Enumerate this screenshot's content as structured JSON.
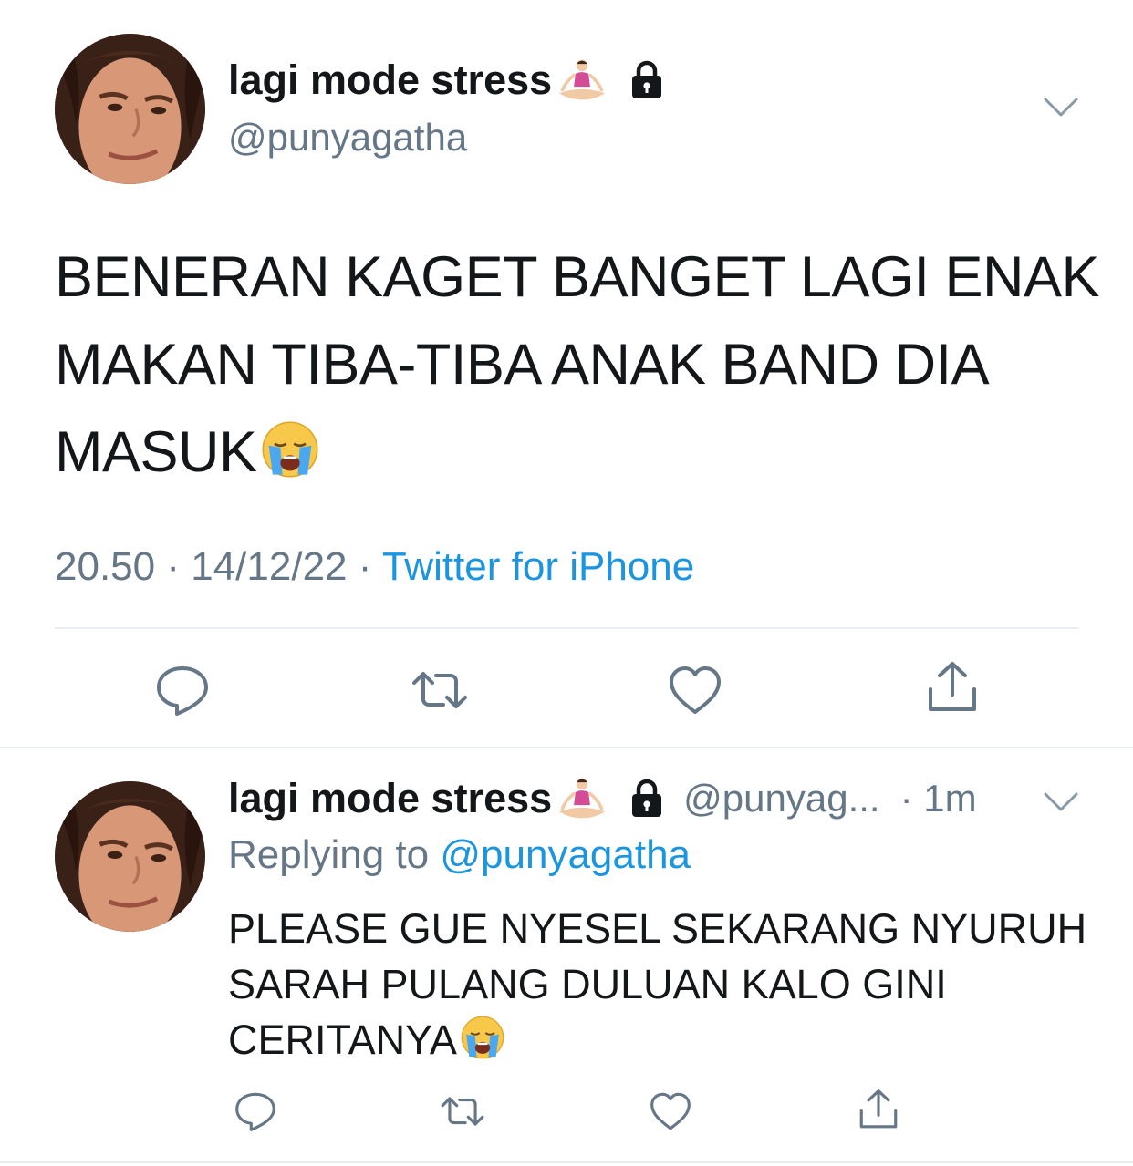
{
  "main_tweet": {
    "display_name": "lagi mode stress",
    "name_emoji": "person-in-lotus-position-emoji",
    "protected_icon": "lock-icon",
    "handle": "@punyagatha",
    "text": "BENERAN KAGET BANGET LAGI ENAK MAKAN TIBA-TIBA ANAK BAND DIA MASUK",
    "text_emoji": "loudly-crying-face-emoji",
    "time": "20.50",
    "separator": "·",
    "date": "14/12/22",
    "source": "Twitter for iPhone",
    "actions": [
      "reply-icon",
      "retweet-icon",
      "like-icon",
      "share-icon"
    ]
  },
  "reply_tweet": {
    "display_name": "lagi mode stress",
    "handle": "@punyag...",
    "time": "· 1m",
    "replying_prefix": "Replying to",
    "replying_to": "@punyagatha",
    "text": "PLEASE GUE NYESEL SEKARANG NYURUH SARAH PULANG DULUAN KALO GINI CERITANYA",
    "text_emoji": "loudly-crying-face-emoji",
    "actions": [
      "reply-icon",
      "retweet-icon",
      "like-icon",
      "share-icon"
    ]
  },
  "colors": {
    "text": "#14171a",
    "secondary": "#657786",
    "link": "#1b95e0",
    "divider": "#e6ecf0"
  }
}
